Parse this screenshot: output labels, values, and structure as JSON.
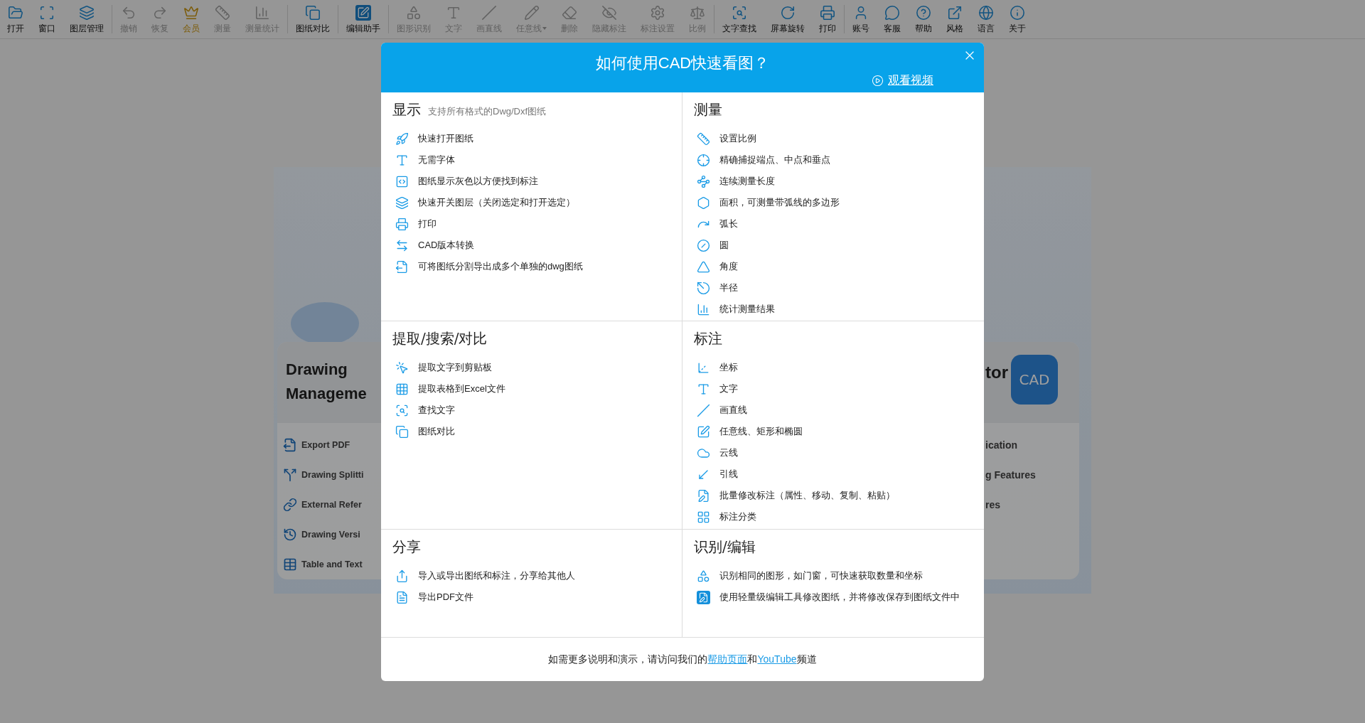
{
  "toolbar": {
    "groups": [
      [
        {
          "label": "打开",
          "kind": "button",
          "disabled": false
        },
        {
          "label": "窗口",
          "kind": "button",
          "disabled": false
        },
        {
          "label": "图层管理",
          "kind": "button",
          "disabled": false
        }
      ],
      [
        {
          "label": "撤销",
          "kind": "button",
          "disabled": true
        },
        {
          "label": "恢复",
          "kind": "button",
          "disabled": true
        },
        {
          "label": "会员",
          "kind": "vip",
          "disabled": false
        },
        {
          "label": "测量",
          "kind": "button",
          "disabled": true
        },
        {
          "label": "测量统计",
          "kind": "button",
          "disabled": true
        }
      ],
      [
        {
          "label": "图纸对比",
          "kind": "button",
          "disabled": false
        }
      ],
      [
        {
          "label": "编辑助手",
          "kind": "button",
          "disabled": false
        }
      ],
      [
        {
          "label": "图形识别",
          "kind": "button",
          "disabled": true
        },
        {
          "label": "文字",
          "kind": "button",
          "disabled": true
        },
        {
          "label": "画直线",
          "kind": "button",
          "disabled": true
        },
        {
          "label": "任意线",
          "kind": "menu",
          "disabled": true
        },
        {
          "label": "删除",
          "kind": "button",
          "disabled": true
        },
        {
          "label": "隐藏标注",
          "kind": "button",
          "disabled": true
        },
        {
          "label": "标注设置",
          "kind": "button",
          "disabled": true
        },
        {
          "label": "比例",
          "kind": "button",
          "disabled": true
        }
      ],
      [
        {
          "label": "文字查找",
          "kind": "button",
          "disabled": false
        },
        {
          "label": "屏幕旋转",
          "kind": "button",
          "disabled": false
        },
        {
          "label": "打印",
          "kind": "button",
          "disabled": false
        }
      ],
      [
        {
          "label": "账号",
          "kind": "button",
          "disabled": false
        },
        {
          "label": "客服",
          "kind": "button",
          "disabled": false
        },
        {
          "label": "帮助",
          "kind": "button",
          "disabled": false
        },
        {
          "label": "风格",
          "kind": "button",
          "disabled": false
        },
        {
          "label": "语言",
          "kind": "button",
          "disabled": false
        },
        {
          "label": "关于",
          "kind": "button",
          "disabled": false
        }
      ]
    ]
  },
  "background_app": {
    "left_card": {
      "title": [
        "Drawing",
        "Manageme"
      ],
      "items": [
        "Export PDF",
        "Drawing Splitti",
        "External Refer",
        "Drawing Versi",
        "Table and Text"
      ]
    },
    "right_card": {
      "title": "tor",
      "logo_text": "CAD",
      "items": [
        "ication",
        "g Features",
        "res"
      ]
    }
  },
  "dialog": {
    "title": "如何使用CAD快速看图？",
    "video_link": "观看视频",
    "sections": [
      {
        "title": "显示",
        "subtitle": "支持所有格式的Dwg/Dxf图纸",
        "items": [
          "快速打开图纸",
          "无需字体",
          "图纸显示灰色以方便找到标注",
          "快速开关图层（关闭选定和打开选定）",
          "打印",
          "CAD版本转换",
          "可将图纸分割导出成多个单独的dwg图纸"
        ]
      },
      {
        "title": "测量",
        "items": [
          "设置比例",
          "精确捕捉端点、中点和垂点",
          "连续测量长度",
          "面积，可测量带弧线的多边形",
          "弧长",
          "圆",
          "角度",
          "半径",
          "统计测量结果"
        ]
      },
      {
        "title": "提取/搜索/对比",
        "items": [
          "提取文字到剪贴板",
          "提取表格到Excel文件",
          "查找文字",
          "图纸对比"
        ]
      },
      {
        "title": "标注",
        "items": [
          "坐标",
          "文字",
          "画直线",
          "任意线、矩形和椭圆",
          "云线",
          "引线",
          "批量修改标注（属性、移动、复制、粘贴）",
          "标注分类"
        ]
      },
      {
        "title": "分享",
        "items": [
          "导入或导出图纸和标注，分享给其他人",
          "导出PDF文件"
        ]
      },
      {
        "title": "识别/编辑",
        "items": [
          "识别相同的图形，如门窗，可快速获取数量和坐标",
          "使用轻量级编辑工具修改图纸，并将修改保存到图纸文件中"
        ]
      }
    ],
    "footer": [
      {
        "kind": "text",
        "text": "如需更多说明和演示，请访问我们的"
      },
      {
        "kind": "link",
        "text": "帮助页面"
      },
      {
        "kind": "text",
        "text": "和"
      },
      {
        "kind": "link",
        "text": "YouTube"
      },
      {
        "kind": "text",
        "text": "频道"
      }
    ]
  }
}
